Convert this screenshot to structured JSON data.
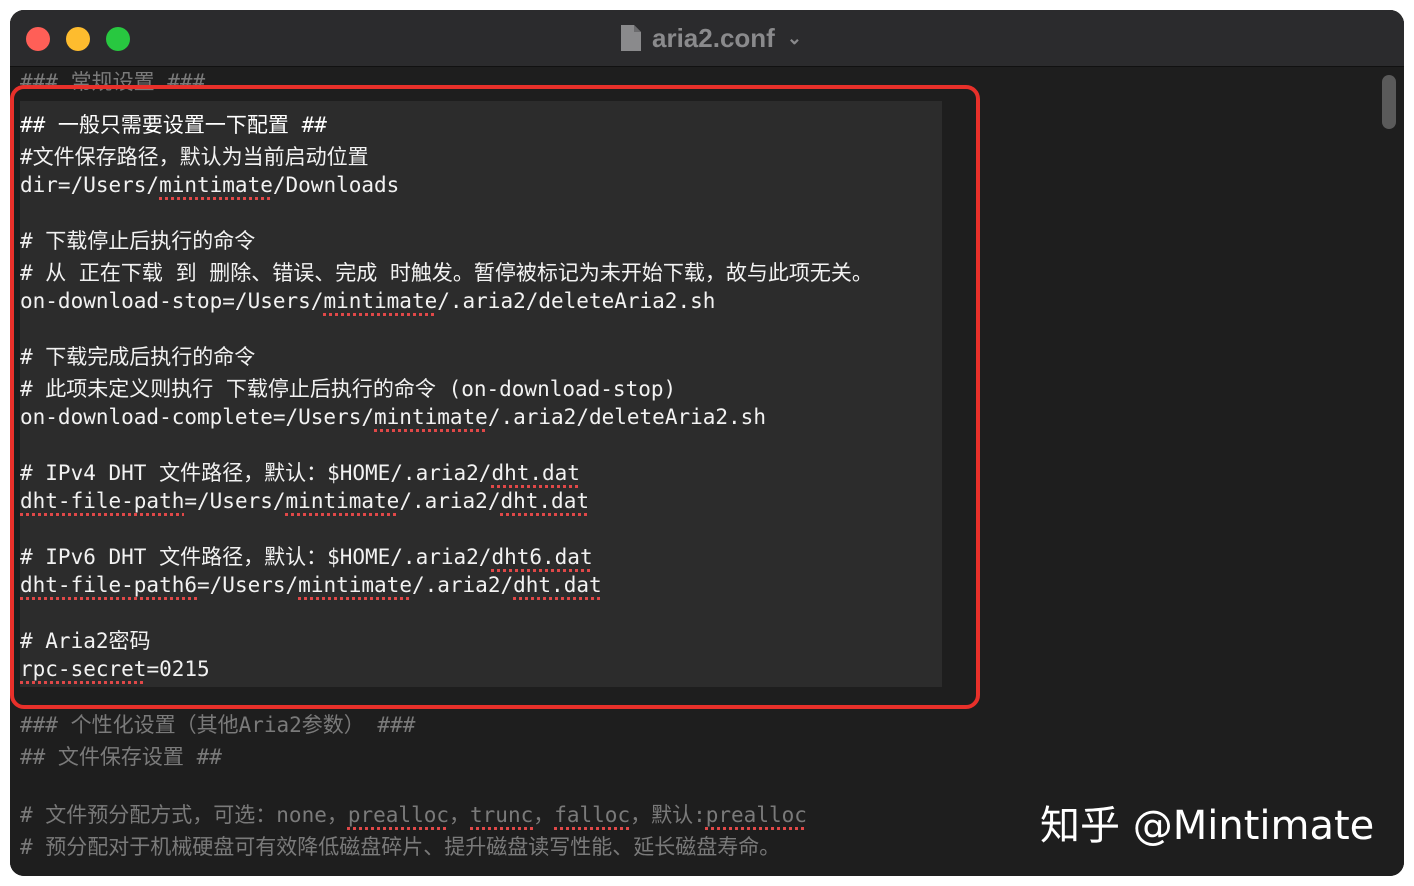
{
  "window": {
    "title": "aria2.conf",
    "chevron": "⌄",
    "controls": {
      "close_color": "#ff5f57",
      "minimize_color": "#febc2e",
      "maximize_color": "#28c840"
    }
  },
  "editor": {
    "lines": [
      {
        "text": "### 常规设置 ###",
        "style": "dim"
      },
      {
        "text": "## 一般只需要设置一下配置 ##"
      },
      {
        "text": "#文件保存路径，默认为当前启动位置"
      },
      {
        "parts": [
          "dir=/Users/",
          "mintimate",
          "/Downloads"
        ]
      },
      {
        "text": ""
      },
      {
        "text": "# 下载停止后执行的命令"
      },
      {
        "text": "# 从 正在下载 到 删除、错误、完成 时触发。暂停被标记为未开始下载，故与此项无关。"
      },
      {
        "parts": [
          "on-download-stop=/Users/",
          "mintimate",
          "/.aria2/deleteAria2.sh"
        ]
      },
      {
        "text": ""
      },
      {
        "text": "# 下载完成后执行的命令"
      },
      {
        "text": "# 此项未定义则执行 下载停止后执行的命令 (on-download-stop)"
      },
      {
        "parts": [
          "on-download-complete=/Users/",
          "mintimate",
          "/.aria2/deleteAria2.sh"
        ]
      },
      {
        "text": ""
      },
      {
        "parts": [
          "# IPv4 DHT 文件路径，默认：$HOME/.aria2/",
          "dht.dat",
          ""
        ]
      },
      {
        "parts": [
          "dht-file-path",
          "=/Users/",
          "mintimate",
          "/.aria2/",
          "dht.dat"
        ]
      },
      {
        "text": ""
      },
      {
        "parts": [
          "# IPv6 DHT 文件路径，默认：$HOME/.aria2/",
          "dht6.dat",
          ""
        ]
      },
      {
        "parts": [
          "dht-file-path6",
          "=/Users/",
          "mintimate",
          "/.aria2/",
          "dht.dat"
        ]
      },
      {
        "text": ""
      },
      {
        "text": "# Aria2密码"
      },
      {
        "parts": [
          "rpc-secret",
          "=0215"
        ]
      },
      {
        "text": "### 个性化设置（其他Aria2参数） ###",
        "style": "dim"
      },
      {
        "text": "## 文件保存设置 ##",
        "style": "dim"
      },
      {
        "text": "",
        "style": "dim"
      },
      {
        "parts": [
          "# 文件预分配方式，可选：none，",
          "prealloc",
          "，",
          "trunc",
          "，",
          "falloc",
          "，默认:",
          "prealloc"
        ],
        "style": "dim"
      },
      {
        "text": "# 预分配对于机械硬盘可有效降低磁盘碎片、提升磁盘读写性能、延长磁盘寿命。",
        "style": "dim"
      }
    ]
  },
  "watermark": "知乎 @Mintimate",
  "colors": {
    "highlight_border": "#e8302a",
    "spellcheck_underline": "#e04848",
    "editor_background": "#1e1e1e",
    "selection_background": "#2c2c2c"
  }
}
